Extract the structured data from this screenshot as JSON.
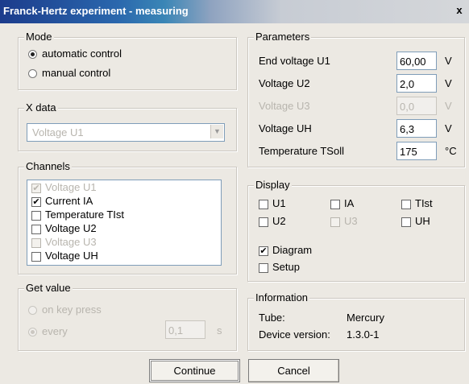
{
  "window": {
    "title": "Franck-Hertz experiment - measuring",
    "close": "x"
  },
  "mode": {
    "legend": "Mode",
    "options": [
      {
        "label": "automatic control",
        "selected": true
      },
      {
        "label": "manual control",
        "selected": false
      }
    ]
  },
  "xdata": {
    "legend": "X data",
    "value": "Voltage U1"
  },
  "channels": {
    "legend": "Channels",
    "items": [
      {
        "label": "Voltage U1",
        "checked": true,
        "disabled": true
      },
      {
        "label": "Current IA",
        "checked": true,
        "disabled": false
      },
      {
        "label": "Temperature TIst",
        "checked": false,
        "disabled": false
      },
      {
        "label": "Voltage U2",
        "checked": false,
        "disabled": false
      },
      {
        "label": "Voltage U3",
        "checked": false,
        "disabled": true
      },
      {
        "label": "Voltage UH",
        "checked": false,
        "disabled": false
      }
    ]
  },
  "getvalue": {
    "legend": "Get value",
    "option1": "on key press",
    "option2": "every",
    "interval": "0,1",
    "unit": "s"
  },
  "parameters": {
    "legend": "Parameters",
    "rows": [
      {
        "label": "End voltage U1",
        "value": "60,00",
        "unit": "V",
        "disabled": false
      },
      {
        "label": "Voltage U2",
        "value": "2,0",
        "unit": "V",
        "disabled": false
      },
      {
        "label": "Voltage U3",
        "value": "0,0",
        "unit": "V",
        "disabled": true
      },
      {
        "label": "Voltage UH",
        "value": "6,3",
        "unit": "V",
        "disabled": false
      },
      {
        "label": "Temperature TSoll",
        "value": "175",
        "unit": "°C",
        "disabled": false
      }
    ]
  },
  "display": {
    "legend": "Display",
    "u1": "U1",
    "ia": "IA",
    "tist": "TIst",
    "u2": "U2",
    "u3": "U3",
    "uh": "UH",
    "diagram": "Diagram",
    "diagram_checked": true,
    "setup": "Setup",
    "setup_checked": false
  },
  "information": {
    "legend": "Information",
    "tube_label": "Tube:",
    "tube_value": "Mercury",
    "device_label": "Device version:",
    "device_value": "1.3.0-1"
  },
  "buttons": {
    "continue": "Continue",
    "cancel": "Cancel"
  }
}
